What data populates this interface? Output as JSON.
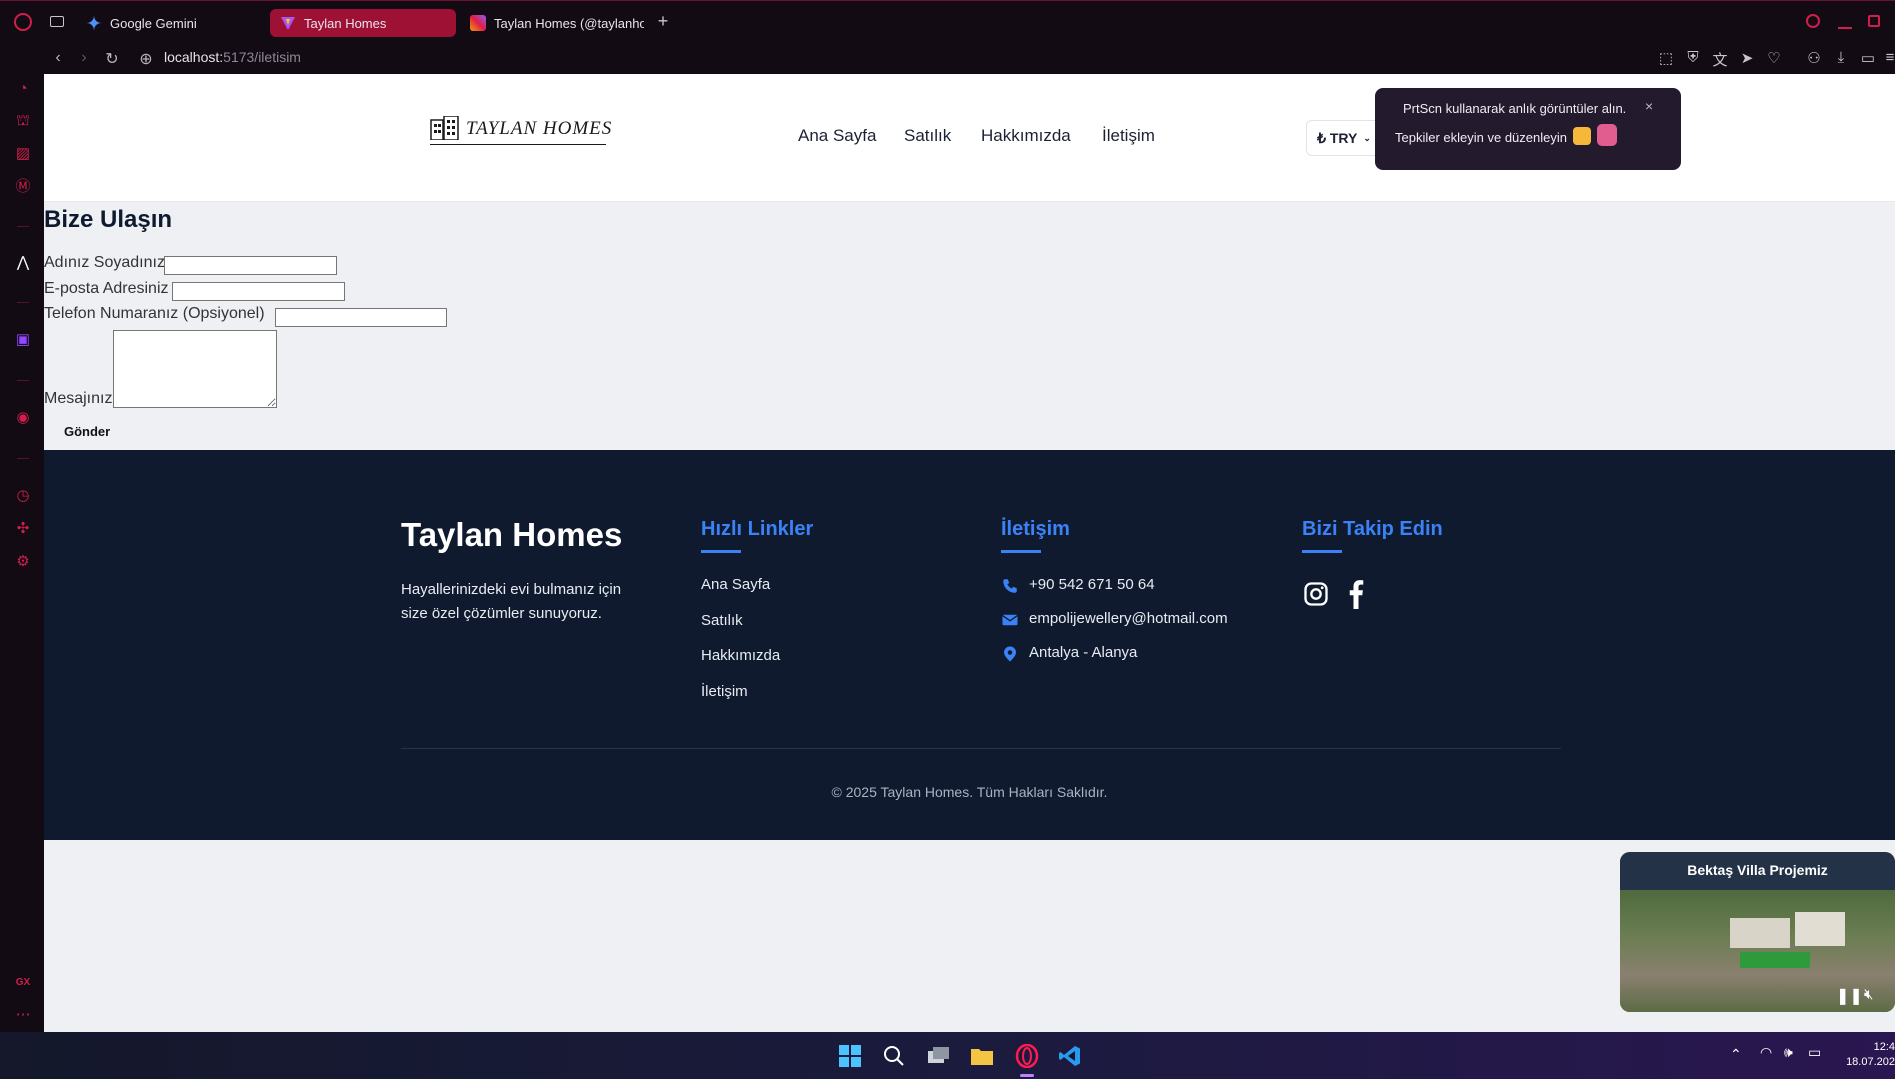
{
  "browser": {
    "tabs": [
      {
        "label": "Google Gemini"
      },
      {
        "label": "Taylan Homes"
      },
      {
        "label": "Taylan Homes (@taylanho"
      }
    ],
    "url_host": "localhost:",
    "url_path": "5173/iletisim"
  },
  "toast": {
    "line1": "PrtScn kullanarak anlık görüntüler alın.",
    "line2": "Tepkiler ekleyin ve düzenleyin",
    "close": "×"
  },
  "header": {
    "logo_text": "TAYLAN HOMES",
    "nav": [
      "Ana Sayfa",
      "Satılık",
      "Hakkımızda",
      "İletişim"
    ],
    "currency": "₺ TRY"
  },
  "form": {
    "title": "Bize Ulaşın",
    "name_label": "Adınız Soyadınız",
    "email_label": "E-posta Adresiniz",
    "phone_label": "Telefon Numaranız (Opsiyonel)",
    "message_label": "Mesajınız",
    "submit_label": "Gönder"
  },
  "footer": {
    "brand": "Taylan Homes",
    "description": "Hayallerinizdeki evi bulmanız için size özel çözümler sunuyoruz.",
    "quick_links_title": "Hızlı Linkler",
    "quick_links": [
      "Ana Sayfa",
      "Satılık",
      "Hakkımızda",
      "İletişim"
    ],
    "contact_title": "İletişim",
    "phone": "+90 542 671 50 64",
    "email": "empolijewellery@hotmail.com",
    "location": "Antalya - Alanya",
    "follow_title": "Bizi Takip Edin",
    "copyright": "© 2025 Taylan Homes. Tüm Hakları Saklıdır."
  },
  "video": {
    "title": "Bektaş Villa Projemiz"
  },
  "taskbar": {
    "time": "12:4",
    "date": "18.07.202"
  },
  "colors": {
    "accent": "#3b82f6",
    "footer_bg": "#0f1a2e",
    "whatsapp": "#25d366",
    "active_tab": "#9e1034"
  }
}
